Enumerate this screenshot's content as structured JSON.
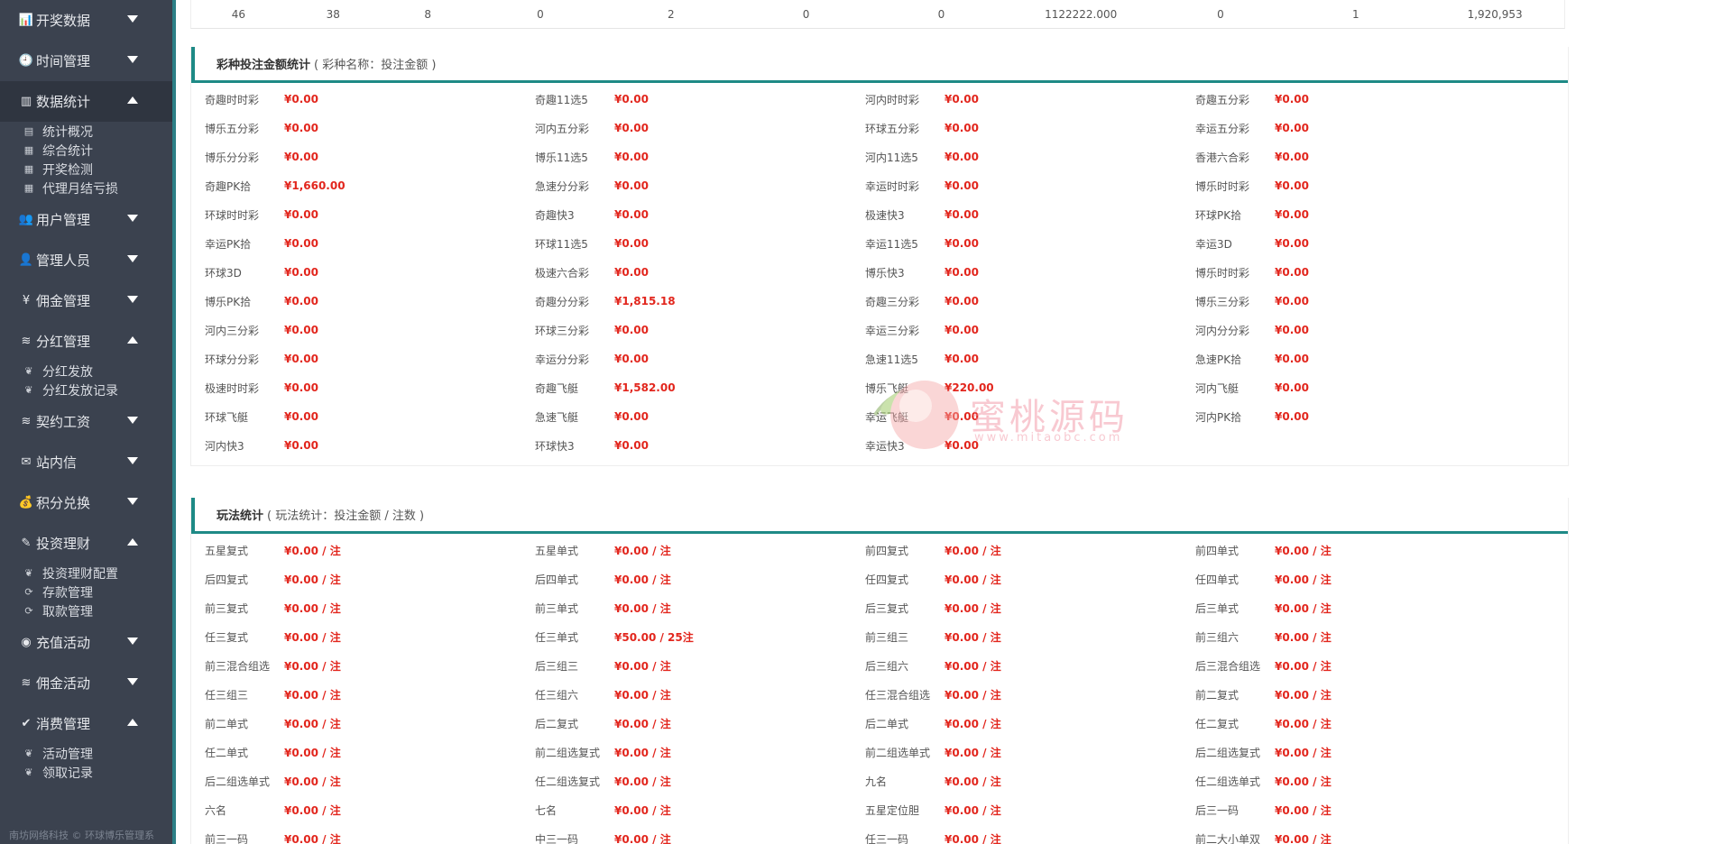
{
  "sidebar": {
    "menus": [
      {
        "label": "开奖数据",
        "icon": "bar-chart-icon",
        "open": false,
        "items": []
      },
      {
        "label": "时间管理",
        "icon": "clock-icon",
        "open": false,
        "items": []
      },
      {
        "label": "数据统计",
        "icon": "stats-icon",
        "open": true,
        "items": [
          {
            "label": "统计概况",
            "icon": "chart-icon"
          },
          {
            "label": "综合统计",
            "icon": "factory-icon"
          },
          {
            "label": "开奖检测",
            "icon": "factory-icon"
          },
          {
            "label": "代理月结亏损",
            "icon": "factory-icon"
          }
        ]
      },
      {
        "label": "用户管理",
        "icon": "users-icon",
        "open": false,
        "items": []
      },
      {
        "label": "管理人员",
        "icon": "user-icon",
        "open": false,
        "items": []
      },
      {
        "label": "佣金管理",
        "icon": "yen-icon",
        "open": false,
        "items": []
      },
      {
        "label": "分红管理",
        "icon": "database-icon",
        "open": true,
        "items": [
          {
            "label": "分红发放",
            "icon": "balloon-icon"
          },
          {
            "label": "分红发放记录",
            "icon": "balloon-icon"
          }
        ]
      },
      {
        "label": "契约工资",
        "icon": "database-icon",
        "open": false,
        "items": []
      },
      {
        "label": "站内信",
        "icon": "mail-icon",
        "open": false,
        "items": []
      },
      {
        "label": "积分兑换",
        "icon": "money-bag-icon",
        "open": false,
        "items": []
      },
      {
        "label": "投资理财",
        "icon": "edit-chart-icon",
        "open": true,
        "items": [
          {
            "label": "投资理财配置",
            "icon": "balloon-icon"
          },
          {
            "label": "存款管理",
            "icon": "refresh-icon"
          },
          {
            "label": "取款管理",
            "icon": "refresh-icon"
          }
        ]
      },
      {
        "label": "充值活动",
        "icon": "person-circle-icon",
        "open": false,
        "items": []
      },
      {
        "label": "佣金活动",
        "icon": "database-icon",
        "open": false,
        "items": []
      },
      {
        "label": "消费管理",
        "icon": "check-edit-icon",
        "open": true,
        "items": [
          {
            "label": "活动管理",
            "icon": "balloon-icon"
          },
          {
            "label": "领取记录",
            "icon": "balloon-icon"
          }
        ]
      }
    ],
    "footer": "南坊网络科技 © 环球博乐管理系"
  },
  "top_row": [
    "46",
    "38",
    "8",
    "0",
    "2",
    "0",
    "0",
    "1122222.000",
    "0",
    "1",
    "1,920,953"
  ],
  "lottery_panel": {
    "title": "彩种投注金额统计",
    "subtitle": "( 彩种名称：投注金额 )",
    "items": [
      [
        "奇趣时时彩",
        "¥0.00"
      ],
      [
        "奇趣11选5",
        "¥0.00"
      ],
      [
        "河内时时彩",
        "¥0.00"
      ],
      [
        "奇趣五分彩",
        "¥0.00"
      ],
      [
        "博乐五分彩",
        "¥0.00"
      ],
      [
        "河内五分彩",
        "¥0.00"
      ],
      [
        "环球五分彩",
        "¥0.00"
      ],
      [
        "幸运五分彩",
        "¥0.00"
      ],
      [
        "博乐分分彩",
        "¥0.00"
      ],
      [
        "博乐11选5",
        "¥0.00"
      ],
      [
        "河内11选5",
        "¥0.00"
      ],
      [
        "香港六合彩",
        "¥0.00"
      ],
      [
        "奇趣PK拾",
        "¥1,660.00"
      ],
      [
        "急速分分彩",
        "¥0.00"
      ],
      [
        "幸运时时彩",
        "¥0.00"
      ],
      [
        "博乐时时彩",
        "¥0.00"
      ],
      [
        "环球时时彩",
        "¥0.00"
      ],
      [
        "奇趣快3",
        "¥0.00"
      ],
      [
        "极速快3",
        "¥0.00"
      ],
      [
        "环球PK拾",
        "¥0.00"
      ],
      [
        "幸运PK拾",
        "¥0.00"
      ],
      [
        "环球11选5",
        "¥0.00"
      ],
      [
        "幸运11选5",
        "¥0.00"
      ],
      [
        "幸运3D",
        "¥0.00"
      ],
      [
        "环球3D",
        "¥0.00"
      ],
      [
        "极速六合彩",
        "¥0.00"
      ],
      [
        "博乐快3",
        "¥0.00"
      ],
      [
        "博乐时时彩",
        "¥0.00"
      ],
      [
        "博乐PK拾",
        "¥0.00"
      ],
      [
        "奇趣分分彩",
        "¥1,815.18"
      ],
      [
        "奇趣三分彩",
        "¥0.00"
      ],
      [
        "博乐三分彩",
        "¥0.00"
      ],
      [
        "河内三分彩",
        "¥0.00"
      ],
      [
        "环球三分彩",
        "¥0.00"
      ],
      [
        "幸运三分彩",
        "¥0.00"
      ],
      [
        "河内分分彩",
        "¥0.00"
      ],
      [
        "环球分分彩",
        "¥0.00"
      ],
      [
        "幸运分分彩",
        "¥0.00"
      ],
      [
        "急速11选5",
        "¥0.00"
      ],
      [
        "急速PK拾",
        "¥0.00"
      ],
      [
        "极速时时彩",
        "¥0.00"
      ],
      [
        "奇趣飞艇",
        "¥1,582.00"
      ],
      [
        "博乐飞艇",
        "¥220.00"
      ],
      [
        "河内飞艇",
        "¥0.00"
      ],
      [
        "环球飞艇",
        "¥0.00"
      ],
      [
        "急速飞艇",
        "¥0.00"
      ],
      [
        "幸运飞艇",
        "¥0.00"
      ],
      [
        "河内PK拾",
        "¥0.00"
      ],
      [
        "河内快3",
        "¥0.00"
      ],
      [
        "环球快3",
        "¥0.00"
      ],
      [
        "幸运快3",
        "¥0.00"
      ]
    ]
  },
  "play_panel": {
    "title": "玩法统计",
    "subtitle": "( 玩法统计：投注金额 / 注数 )",
    "items": [
      [
        "五星复式",
        "¥0.00 / 注"
      ],
      [
        "五星单式",
        "¥0.00 / 注"
      ],
      [
        "前四复式",
        "¥0.00 / 注"
      ],
      [
        "前四单式",
        "¥0.00 / 注"
      ],
      [
        "后四复式",
        "¥0.00 / 注"
      ],
      [
        "后四单式",
        "¥0.00 / 注"
      ],
      [
        "任四复式",
        "¥0.00 / 注"
      ],
      [
        "任四单式",
        "¥0.00 / 注"
      ],
      [
        "前三复式",
        "¥0.00 / 注"
      ],
      [
        "前三单式",
        "¥0.00 / 注"
      ],
      [
        "后三复式",
        "¥0.00 / 注"
      ],
      [
        "后三单式",
        "¥0.00 / 注"
      ],
      [
        "任三复式",
        "¥0.00 / 注"
      ],
      [
        "任三单式",
        "¥50.00 / 25注"
      ],
      [
        "前三组三",
        "¥0.00 / 注"
      ],
      [
        "前三组六",
        "¥0.00 / 注"
      ],
      [
        "前三混合组选",
        "¥0.00 / 注"
      ],
      [
        "后三组三",
        "¥0.00 / 注"
      ],
      [
        "后三组六",
        "¥0.00 / 注"
      ],
      [
        "后三混合组选",
        "¥0.00 / 注"
      ],
      [
        "任三组三",
        "¥0.00 / 注"
      ],
      [
        "任三组六",
        "¥0.00 / 注"
      ],
      [
        "任三混合组选",
        "¥0.00 / 注"
      ],
      [
        "前二复式",
        "¥0.00 / 注"
      ],
      [
        "前二单式",
        "¥0.00 / 注"
      ],
      [
        "后二复式",
        "¥0.00 / 注"
      ],
      [
        "后二单式",
        "¥0.00 / 注"
      ],
      [
        "任二复式",
        "¥0.00 / 注"
      ],
      [
        "任二单式",
        "¥0.00 / 注"
      ],
      [
        "前二组选复式",
        "¥0.00 / 注"
      ],
      [
        "前二组选单式",
        "¥0.00 / 注"
      ],
      [
        "后二组选复式",
        "¥0.00 / 注"
      ],
      [
        "后二组选单式",
        "¥0.00 / 注"
      ],
      [
        "任二组选复式",
        "¥0.00 / 注"
      ],
      [
        "九名",
        "¥0.00 / 注"
      ],
      [
        "任二组选单式",
        "¥0.00 / 注"
      ],
      [
        "六名",
        "¥0.00 / 注"
      ],
      [
        "七名",
        "¥0.00 / 注"
      ],
      [
        "五星定位胆",
        "¥0.00 / 注"
      ],
      [
        "后三一码",
        "¥0.00 / 注"
      ],
      [
        "前三一码",
        "¥0.00 / 注"
      ],
      [
        "中三一码",
        "¥0.00 / 注"
      ],
      [
        "任三一码",
        "¥0.00 / 注"
      ],
      [
        "前二大小单双",
        "¥0.00 / 注"
      ]
    ]
  },
  "watermark": {
    "text": "蜜桃源码",
    "url": "www.mitaobc.com"
  }
}
